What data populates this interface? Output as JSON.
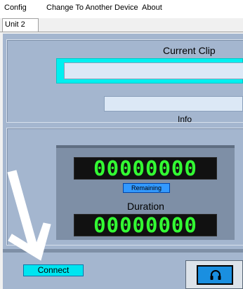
{
  "menu": {
    "items": [
      "Config",
      "Change To Another Device",
      "About"
    ]
  },
  "tabs": [
    "Unit 2"
  ],
  "clip": {
    "title": "Current Clip",
    "value": "",
    "info_label": "Info",
    "info_value": ""
  },
  "timers": {
    "remaining_display": "00000000",
    "remaining_button": "Remaining",
    "duration_label": "Duration",
    "duration_display": "00000000"
  },
  "bottom": {
    "connect_label": "Connect",
    "headphone_icon": "headphone-icon"
  },
  "colors": {
    "panel": "#a4b6cf",
    "clip_highlight": "#00f0f0",
    "display_digits": "#33ff33",
    "remaining_button": "#3399ff",
    "connect_button": "#00e5f0",
    "headphone_button": "#1a8fe0",
    "annotation_arrow": "#ffffff"
  }
}
